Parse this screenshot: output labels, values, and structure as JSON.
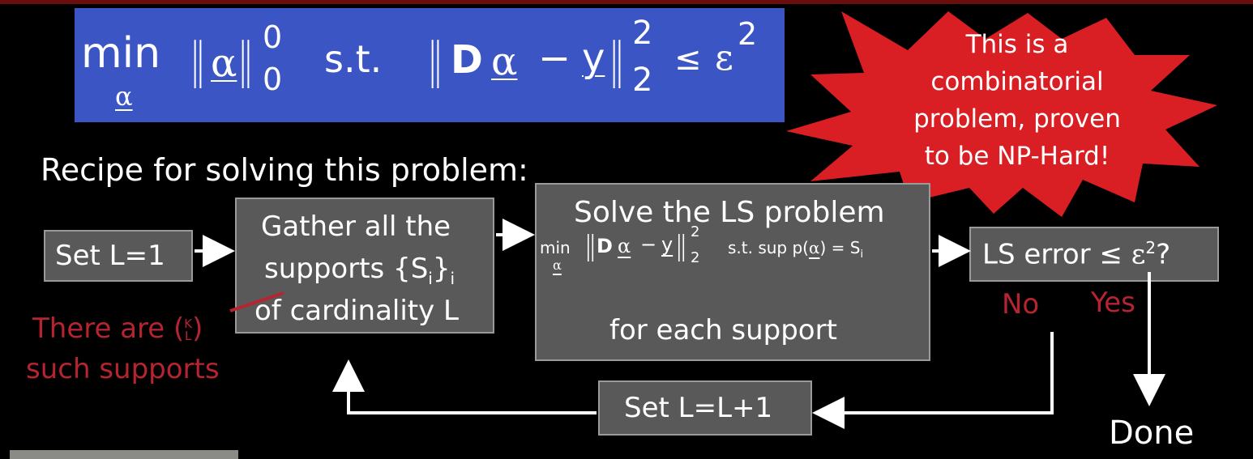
{
  "formula": {
    "min": "min",
    "min_sub": "α",
    "norm_var": "α",
    "norm_sup": "0",
    "norm_sub": "0",
    "st": "s.t.",
    "D": "D",
    "alpha": "α",
    "minus": "−",
    "y": "y",
    "res_sup": "2",
    "res_sub": "2",
    "le": "≤",
    "eps": "ε",
    "eps_sup": "2"
  },
  "starburst": {
    "lines": [
      "This is a",
      "combinatorial",
      "problem, proven",
      "to be NP-Hard!"
    ],
    "fill": "#d91e24"
  },
  "recipe_title": "Recipe for solving this problem:",
  "boxes": {
    "set_l": "Set L=1",
    "gather": {
      "line1": "Gather all the",
      "line2_prefix": "supports {S",
      "line2_sub": "i",
      "line2_brace": "}",
      "line2_suffix_sub": "i",
      "line3": "of cardinality L"
    },
    "solve": {
      "title": "Solve the LS problem",
      "eq_min": "min",
      "eq_min_sub": "α",
      "eq_D": "D",
      "eq_alpha": "α",
      "eq_minus": "−",
      "eq_y": "y",
      "eq_sup": "2",
      "eq_sub": "2",
      "eq_st": "s.t. sup p(",
      "eq_alpha2": "α",
      "eq_close": ") = S",
      "eq_close_sub": "i",
      "footer": "for each support"
    },
    "check": {
      "prefix": "LS error ≤ ",
      "eps": "ε",
      "eps_sup": "2",
      "suffix": "?"
    },
    "increment": "Set L=L+1"
  },
  "branches": {
    "no": "No",
    "yes": "Yes"
  },
  "done": "Done",
  "annotation": {
    "line1_prefix": "There are (",
    "line1_top": "K",
    "line1_bottom": "L",
    "line1_suffix": ")",
    "line2": "such supports"
  },
  "colors": {
    "background": "#000000",
    "formula_bg": "#3b55c4",
    "box_bg": "#595959",
    "annotation_red": "#b52430",
    "starburst_red": "#d91e24"
  }
}
